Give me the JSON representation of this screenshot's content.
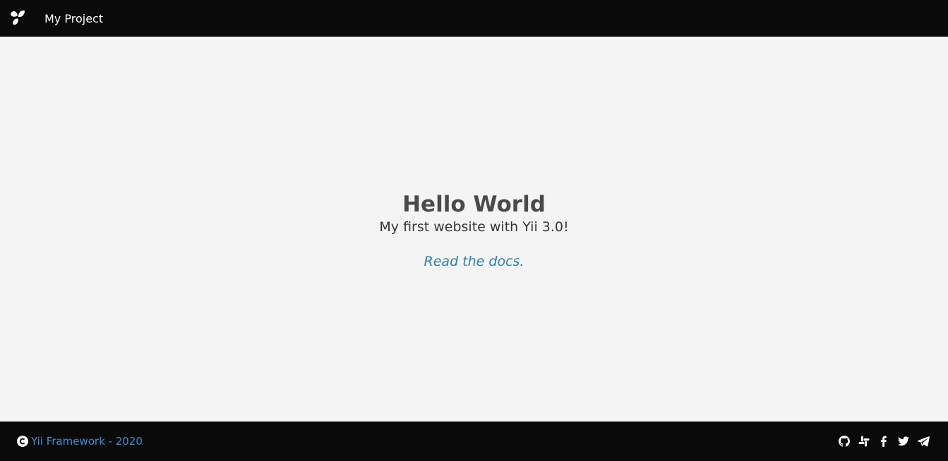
{
  "navbar": {
    "brand_name": "My Project",
    "logo_icon": "yii-logo-icon"
  },
  "hero": {
    "title": "Hello World",
    "subtitle": "My first website with Yii 3.0!",
    "docs_link": "Read the docs."
  },
  "footer": {
    "copyright_icon": "copyright-icon",
    "copyright_text": "Yii Framework - 2020",
    "socials": [
      {
        "icon": "github-icon"
      },
      {
        "icon": "slack-icon"
      },
      {
        "icon": "facebook-icon"
      },
      {
        "icon": "twitter-icon"
      },
      {
        "icon": "telegram-icon"
      }
    ]
  },
  "colors": {
    "navbar_bg": "#0a0a0a",
    "page_bg": "#f4f4f4",
    "link": "#2d7ea8",
    "footer_link": "#3e8ed0"
  }
}
